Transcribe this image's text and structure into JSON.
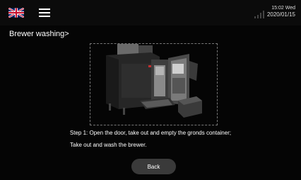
{
  "header": {
    "language_icon": "uk-flag-icon",
    "menu_icon": "hamburger-menu-icon",
    "signal_icon": "signal-strength-icon",
    "time": "15:02 Wed",
    "date": "2020/01/15"
  },
  "page": {
    "title": "Brewer washing>"
  },
  "instructions": {
    "step1": "Step 1: Open the door, take out and empty the gronds container;",
    "step2": "Take out and wash the brewer."
  },
  "buttons": {
    "back": "Back"
  },
  "colors": {
    "background": "#050505",
    "button": "#3a3a3a"
  }
}
